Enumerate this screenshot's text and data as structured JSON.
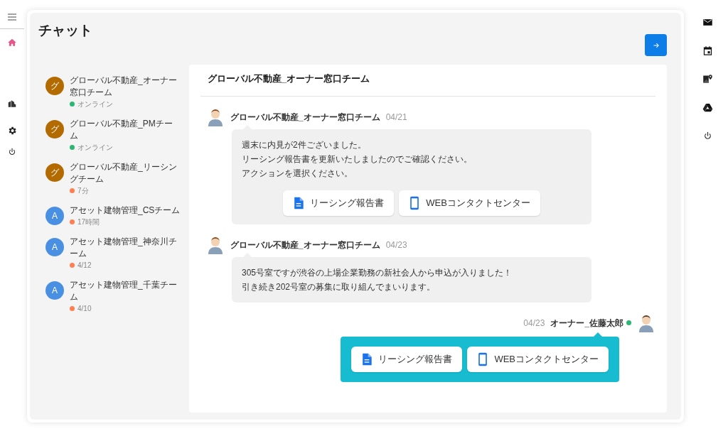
{
  "page_title": "チャット",
  "conversations": [
    {
      "avatar": {
        "letter": "グ",
        "color": "#b36b00"
      },
      "name": "グローバル不動産_オーナー窓口チーム",
      "status": "オンライン",
      "color": "#2bb673"
    },
    {
      "avatar": {
        "letter": "グ",
        "color": "#b36b00"
      },
      "name": "グローバル不動産_PMチーム",
      "status": "オンライン",
      "color": "#2bb673"
    },
    {
      "avatar": {
        "letter": "グ",
        "color": "#b36b00"
      },
      "name": "グローバル不動産_リーシングチーム",
      "status": "7分",
      "color": "#ff7f50"
    },
    {
      "avatar": {
        "letter": "A",
        "color": "#4a90e2"
      },
      "name": "アセット建物管理_CSチーム",
      "status": "17時間",
      "color": "#ff7f50"
    },
    {
      "avatar": {
        "letter": "A",
        "color": "#4a90e2"
      },
      "name": "アセット建物管理_神奈川チーム",
      "status": "4/12",
      "color": "#ff7f50"
    },
    {
      "avatar": {
        "letter": "A",
        "color": "#4a90e2"
      },
      "name": "アセット建物管理_千葉チーム",
      "status": "4/10",
      "color": "#ff7f50"
    }
  ],
  "chat": {
    "title": "グローバル不動産_オーナー窓口チーム",
    "messages": [
      {
        "kind": "incoming",
        "sender": "グローバル不動産_オーナー窓口チーム",
        "date": "04/21",
        "lines": [
          "週末に内見が2件ございました。",
          "リーシング報告書を更新いたしましたのでご確認ください。",
          "アクションを選択ください。"
        ],
        "actions": [
          {
            "kind": "document",
            "label": "リーシング報告書"
          },
          {
            "kind": "phone",
            "label": "WEBコンタクトセンター"
          }
        ]
      },
      {
        "kind": "incoming",
        "sender": "グローバル不動産_オーナー窓口チーム",
        "date": "04/23",
        "lines": [
          "305号室ですが渋谷の上場企業勤務の新社会人から申込が入りました！",
          "引き続き202号室の募集に取り組んでまいります。"
        ]
      },
      {
        "kind": "outgoing",
        "sender": "オーナー_佐藤太郎",
        "date": "04/23",
        "online": true,
        "actions": [
          {
            "kind": "document",
            "label": "リーシング報告書"
          },
          {
            "kind": "phone",
            "label": "WEBコンタクトセンター"
          }
        ]
      }
    ]
  }
}
